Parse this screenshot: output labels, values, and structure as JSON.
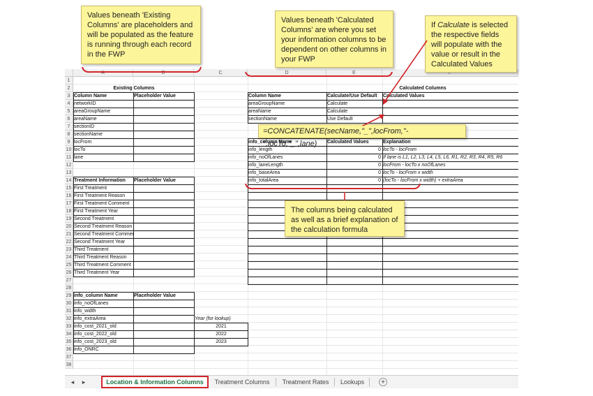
{
  "columns": [
    "A",
    "B",
    "C",
    "D",
    "E",
    "F"
  ],
  "rows": [
    "1",
    "2",
    "3",
    "4",
    "5",
    "6",
    "7",
    "8",
    "9",
    "10",
    "11",
    "12",
    "13",
    "14",
    "15",
    "16",
    "17",
    "18",
    "19",
    "20",
    "21",
    "22",
    "23",
    "24",
    "25",
    "26",
    "27",
    "28",
    "29",
    "30",
    "31",
    "32",
    "33",
    "34",
    "35",
    "36",
    "37",
    "38"
  ],
  "cells": {
    "existing_columns_title": "Existing Columns",
    "calculated_columns_title": "Calculated Columns",
    "col_name_header": "Column Name",
    "placeholder_header": "Placeholder Value",
    "existing_col_names": [
      "networkID",
      "areaGroupName",
      "areaName",
      "sectionID",
      "sectionName",
      "locFrom",
      "locTo",
      "lane"
    ],
    "treatment_header": "Treatment Information",
    "treatment_placeholder_header": "Placeholder Value",
    "treatment_items": [
      "First Treatment",
      "First Treatment Reason",
      "First Treatment Comment",
      "First Treatment Year",
      "Second Treatment",
      "Second Treatment Reason",
      "Second Treatment Comment",
      "Second Treatment Year",
      "Third Treatment",
      "Third Treatment Reason",
      "Third Treatment Comment",
      "Third Treatment Year"
    ],
    "info_col_header": "info_column Name",
    "info_placeholder_header": "Placeholder Value",
    "info_items": [
      "info_noOfLanes",
      "info_width",
      "info_extraArea",
      "info_cost_2021_old",
      "info_cost_2022_old",
      "info_cost_2023_old",
      "info_ONRC"
    ],
    "year_lookup_label": "Year (for lookup)",
    "years": [
      "2021",
      "2022",
      "2023"
    ],
    "calc_col_name_header": "Column Name",
    "calc_use_default_header": "Calculate/Use Default",
    "calc_values_header": "Calculated Values",
    "calc_rows": [
      {
        "name": "areaGroupName",
        "mode": "Calculate"
      },
      {
        "name": "areaName",
        "mode": "Calculate"
      },
      {
        "name": "sectionName",
        "mode": "Use Default"
      }
    ],
    "info_calc_header": "info_column Name",
    "info_calc_values_header": "Calculated Values",
    "explanation_header": "Explanation",
    "info_calc_rows": [
      {
        "name": "info_length",
        "value": "0",
        "explanation": "locTo - locFrom"
      },
      {
        "name": "info_noOfLanes",
        "value": "0",
        "explanation": "If lane is L1, L2, L3, L4, L5, L6, R1, R2, R3, R4, R5, R6"
      },
      {
        "name": "info_laneLength",
        "value": "0",
        "explanation": "locFrom - locTo x noOfLanes"
      },
      {
        "name": "info_baseArea",
        "value": "0",
        "explanation": "locTo - locFrom x width"
      },
      {
        "name": "info_totalArea",
        "value": "0",
        "explanation": "(locTo - locFrom x width) + extraArea"
      }
    ]
  },
  "annotations": {
    "note_existing": "Values beneath 'Existing Columns' are placeholders and will be populated as the feature is running through each record in the FWP",
    "note_calculated": "Values beneath 'Calculated Columns' are where you set your information columns to be dependent on other columns in your FWP",
    "note_calculate_pre": "If ",
    "note_calculate_em": "Calculate",
    "note_calculate_post": " is selected the respective fields will populate with the value or result in the Calculated Values",
    "formula": "=CONCATENATE(secName,\"_\",locFrom,\"-\",locTo,\"_\",lane)",
    "note_formula_expl": "The columns being calculated as well as a brief explanation of the calculation formula"
  },
  "tabs": {
    "nav_prev": "◂",
    "nav_next": "▸",
    "items": [
      "Location & Information Columns",
      "Treatment Columns",
      "Treatment Rates",
      "Lookups"
    ],
    "active": "Location & Information Columns",
    "add_label": "+"
  },
  "colors": {
    "callout_bracket": "#d0262b",
    "note_fill": "#fdf59a",
    "active_tab_border": "#d0262b",
    "active_tab_text": "#1e7145"
  }
}
